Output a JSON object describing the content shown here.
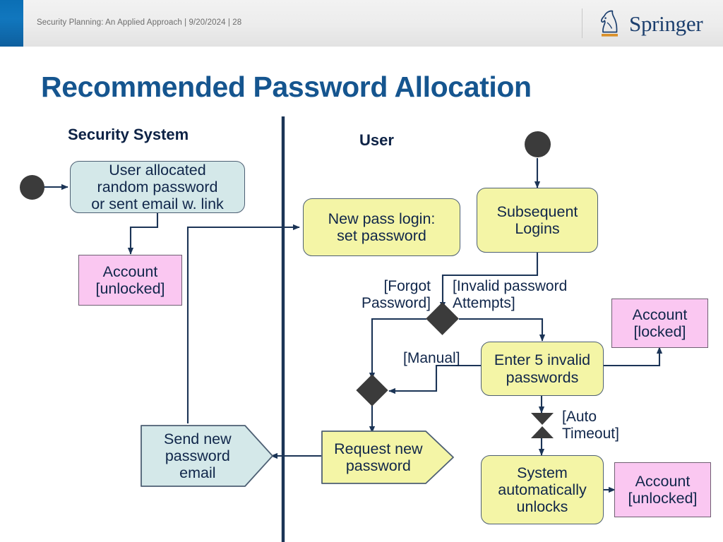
{
  "header": {
    "meta": "Security Planning: An Applied Approach | 9/20/2024 | 28",
    "brand": "Springer",
    "brand_icon": "springer-knight-icon",
    "accent_color": "#0e6eb4"
  },
  "slide": {
    "title": "Recommended Password Allocation"
  },
  "lanes": [
    {
      "id": "security-system",
      "label": "Security System"
    },
    {
      "id": "user",
      "label": "User"
    }
  ],
  "nodes": {
    "start_security": {
      "type": "initial",
      "label": ""
    },
    "start_user": {
      "type": "initial",
      "label": ""
    },
    "user_allocated": {
      "type": "activity",
      "label": "User allocated\nrandom password\nor sent email w. link",
      "fill": "#d4e8e9"
    },
    "account_unlocked_1": {
      "type": "state",
      "label": "Account\n[unlocked]",
      "fill": "#fac7f1"
    },
    "new_pass_login": {
      "type": "activity",
      "label": "New pass login:\nset password",
      "fill": "#f4f5a6"
    },
    "subsequent_logins": {
      "type": "activity",
      "label": "Subsequent\nLogins",
      "fill": "#f4f5a6"
    },
    "enter_5_invalid": {
      "type": "activity",
      "label": "Enter 5 invalid\npasswords",
      "fill": "#f4f5a6"
    },
    "account_locked": {
      "type": "state",
      "label": "Account\n[locked]",
      "fill": "#fac7f1"
    },
    "system_unlocks": {
      "type": "activity",
      "label": "System\nautomatically\nunlocks",
      "fill": "#f4f5a6"
    },
    "account_unlocked_2": {
      "type": "state",
      "label": "Account\n[unlocked]",
      "fill": "#fac7f1"
    },
    "send_new_password_email": {
      "type": "signal",
      "label": "Send new\npassword\nemail",
      "fill": "#d4e8e9"
    },
    "request_new_password": {
      "type": "signal",
      "label": "Request new\npassword",
      "fill": "#f4f5a6"
    },
    "decision_login": {
      "type": "decision",
      "label": ""
    },
    "decision_reset": {
      "type": "decision",
      "label": ""
    },
    "auto_timeout_event": {
      "type": "time-event",
      "label": ""
    }
  },
  "guards": {
    "forgot_password": "[Forgot\nPassword]",
    "invalid_password_attempts": "[Invalid password\nAttempts]",
    "manual": "[Manual]",
    "auto_timeout": "[Auto\nTimeout]"
  },
  "colors": {
    "activity_blue": "#d4e8e9",
    "activity_yellow": "#f4f5a6",
    "state_pink": "#fac7f1",
    "line": "#1b3456",
    "title_blue": "#15558f",
    "node_dark": "#3b3b3b"
  }
}
